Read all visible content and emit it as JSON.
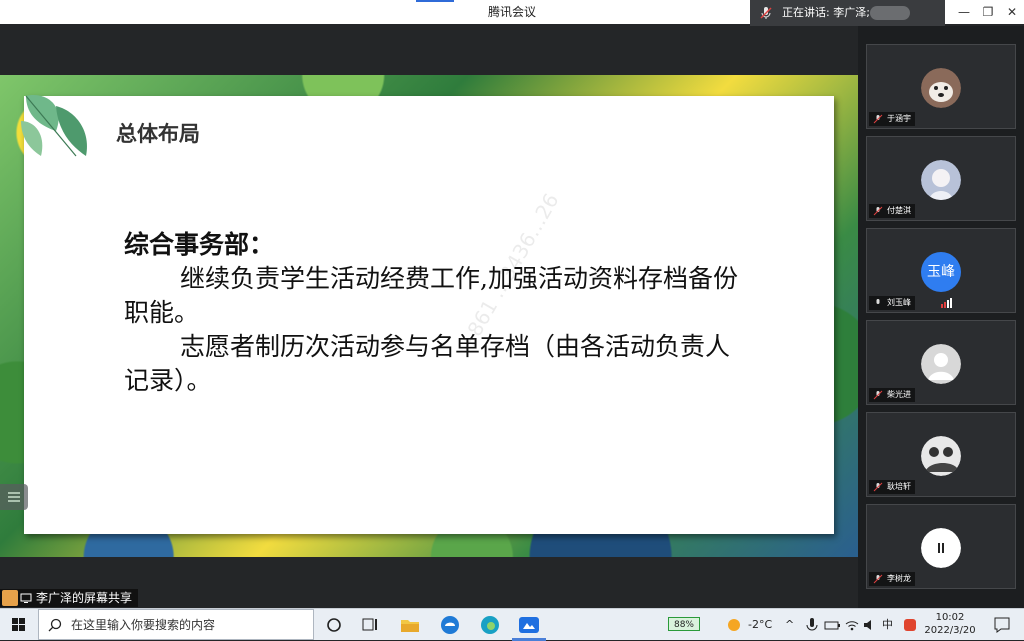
{
  "window": {
    "title": "腾讯会议"
  },
  "speaking": {
    "label": "正在讲话: 李广泽;"
  },
  "slide": {
    "heading": "总体布局",
    "subtitle": "综合事务部：",
    "paragraph1": "继续负责学生活动经费工作,加强活动资料存档备份职能。",
    "paragraph2": "志愿者制历次活动参与名单存档（由各活动负责人记录）。",
    "watermark": "+861 …3436…26"
  },
  "participants": [
    {
      "name": "于涵宇",
      "avatar": "dog-avatar"
    },
    {
      "name": "付楚淇",
      "avatar": "anime-avatar"
    },
    {
      "name": "刘玉峰",
      "avatar_text": "玉峰",
      "avatar_color": "#2f7df0"
    },
    {
      "name": "柴光进",
      "avatar": "default-avatar"
    },
    {
      "name": "耿培轩",
      "avatar": "group-photo-avatar"
    },
    {
      "name": "李树龙",
      "avatar": "pause-avatar"
    }
  ],
  "share": {
    "label": "李广泽的屏幕共享"
  },
  "taskbar": {
    "search_placeholder": "在这里输入你要搜索的内容",
    "battery": "88%",
    "weather": "-2°C",
    "ime": "中",
    "time": "10:02",
    "date": "2022/3/20"
  },
  "colors": {
    "accent": "#2f7df0",
    "bg": "#242628"
  }
}
